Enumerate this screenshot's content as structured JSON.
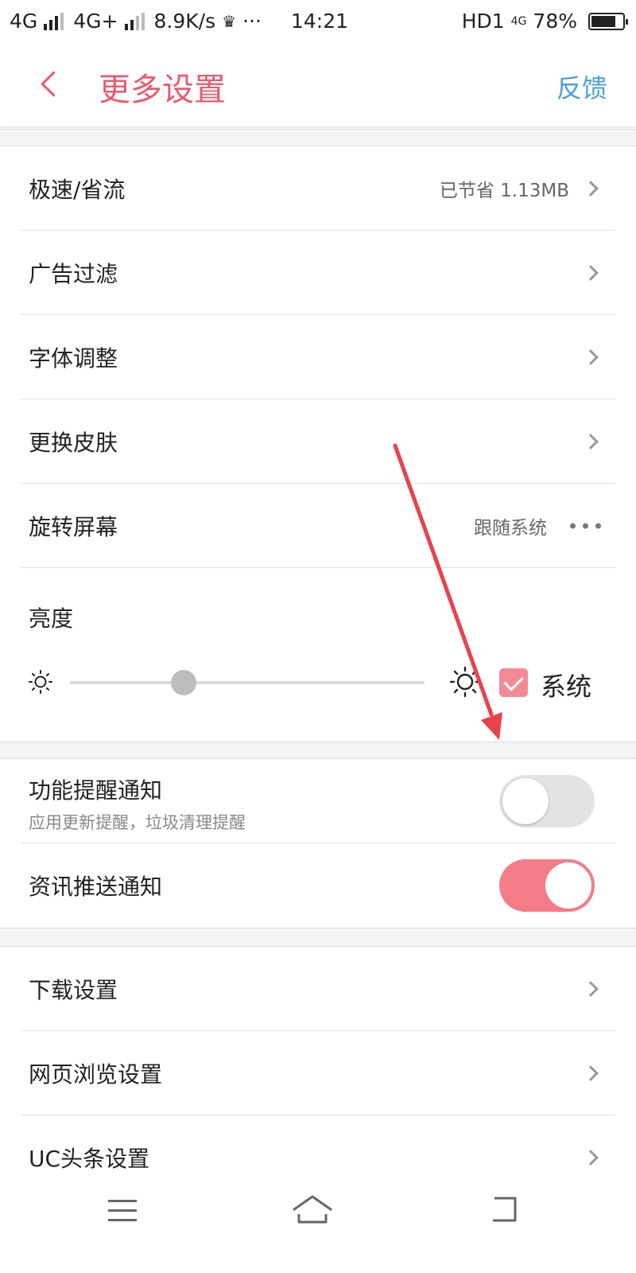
{
  "status_bar": {
    "net1": "4G",
    "net2": "4G+",
    "speed": "8.9K/s",
    "more": "···",
    "time": "14:21",
    "hd": "HD1",
    "net3": "4G",
    "battery_pct": "78%",
    "battery_level": 0.78
  },
  "header": {
    "title": "更多设置",
    "feedback": "反馈",
    "accent_color": "#e95a6d",
    "link_color": "#4a9fd8"
  },
  "settings_group1": [
    {
      "label": "极速/省流",
      "value": "已节省 1.13MB"
    },
    {
      "label": "广告过滤",
      "value": ""
    },
    {
      "label": "字体调整",
      "value": ""
    },
    {
      "label": "更换皮肤",
      "value": ""
    },
    {
      "label": "旋转屏幕",
      "value": "跟随系统"
    }
  ],
  "brightness": {
    "label": "亮度",
    "level": 0.32,
    "system_checked": true,
    "system_label": "系统"
  },
  "notifications": {
    "feature": {
      "title": "功能提醒通知",
      "subtitle": "应用更新提醒，垃圾清理提醒",
      "enabled": false
    },
    "news": {
      "title": "资讯推送通知",
      "enabled": true
    }
  },
  "settings_group2": [
    {
      "label": "下载设置"
    },
    {
      "label": "网页浏览设置"
    },
    {
      "label": "UC头条设置"
    }
  ],
  "icons": [
    "back-chevron-icon",
    "chevron-right-icon",
    "more-dots-icon",
    "sun-small-icon",
    "sun-large-icon",
    "menu-icon",
    "home-icon",
    "back-icon"
  ]
}
